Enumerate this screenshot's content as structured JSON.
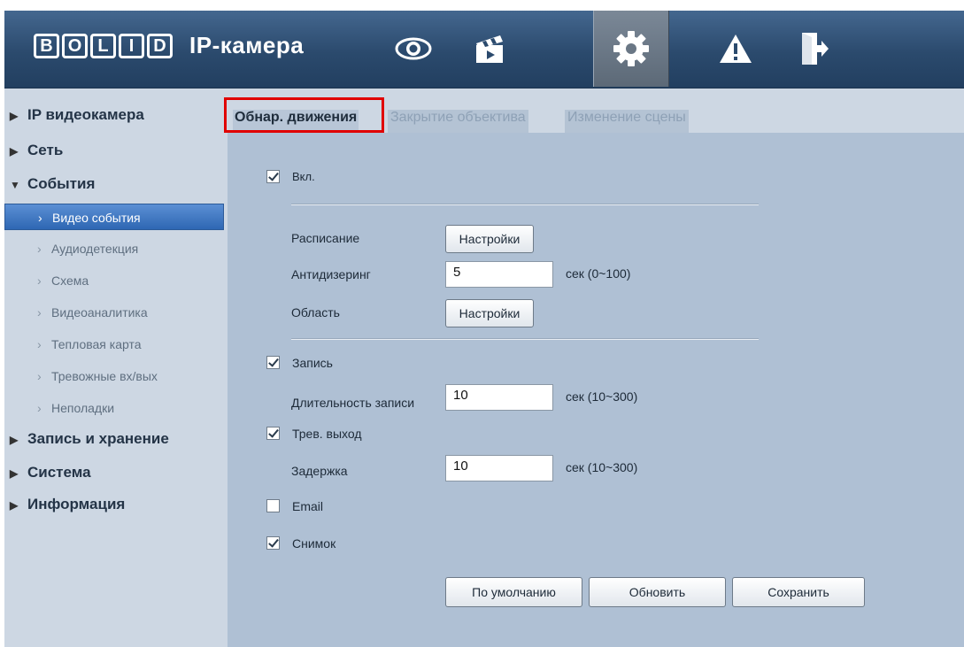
{
  "header": {
    "brand_letters": [
      "B",
      "O",
      "L",
      "I",
      "D"
    ],
    "product": "IP-камера",
    "nav": [
      {
        "icon": "eye-icon",
        "active": false
      },
      {
        "icon": "clapperboard-icon",
        "active": false
      },
      {
        "icon": "gear-icon",
        "active": true
      },
      {
        "icon": "warning-icon",
        "active": false
      },
      {
        "icon": "exit-door-icon",
        "active": false
      }
    ]
  },
  "sidebar": {
    "items": [
      {
        "label": "IP видеокамера",
        "expanded": false
      },
      {
        "label": "Сеть",
        "expanded": false
      },
      {
        "label": "События",
        "expanded": true
      },
      {
        "label": "Запись и хранение",
        "expanded": false
      },
      {
        "label": "Система",
        "expanded": false
      },
      {
        "label": "Информация",
        "expanded": false
      }
    ],
    "sub_items": [
      {
        "label": "Видео события",
        "active": true
      },
      {
        "label": "Аудиодетекция",
        "active": false
      },
      {
        "label": "Схема",
        "active": false
      },
      {
        "label": "Видеоаналитика",
        "active": false
      },
      {
        "label": "Тепловая карта",
        "active": false
      },
      {
        "label": "Тревожные вх/вых",
        "active": false
      },
      {
        "label": "Неполадки",
        "active": false
      }
    ]
  },
  "tabs": [
    {
      "label": "Обнар. движения",
      "active": true
    },
    {
      "label": "Закрытие объектива",
      "active": false
    },
    {
      "label": "Изменение сцены",
      "active": false
    }
  ],
  "form": {
    "enable": {
      "label": "Вкл.",
      "checked": true
    },
    "schedule": {
      "label": "Расписание",
      "button": "Настройки"
    },
    "antidither": {
      "label": "Антидизеринг",
      "value": "5",
      "hint": "сек (0~100)"
    },
    "area": {
      "label": "Область",
      "button": "Настройки"
    },
    "record": {
      "label": "Запись",
      "checked": true
    },
    "record_duration": {
      "label": "Длительность записи",
      "value": "10",
      "hint": "сек (10~300)"
    },
    "alarm_out": {
      "label": "Трев. выход",
      "checked": true
    },
    "delay": {
      "label": "Задержка",
      "value": "10",
      "hint": "сек (10~300)"
    },
    "email": {
      "label": "Email",
      "checked": false
    },
    "snapshot": {
      "label": "Снимок",
      "checked": true
    }
  },
  "buttons": {
    "default": "По умолчанию",
    "refresh": "Обновить",
    "save": "Сохранить"
  },
  "colors": {
    "header": "#2b4a6d",
    "panel": "#afc0d4",
    "active_item": "#2e67b3",
    "highlight": "#e00000"
  }
}
